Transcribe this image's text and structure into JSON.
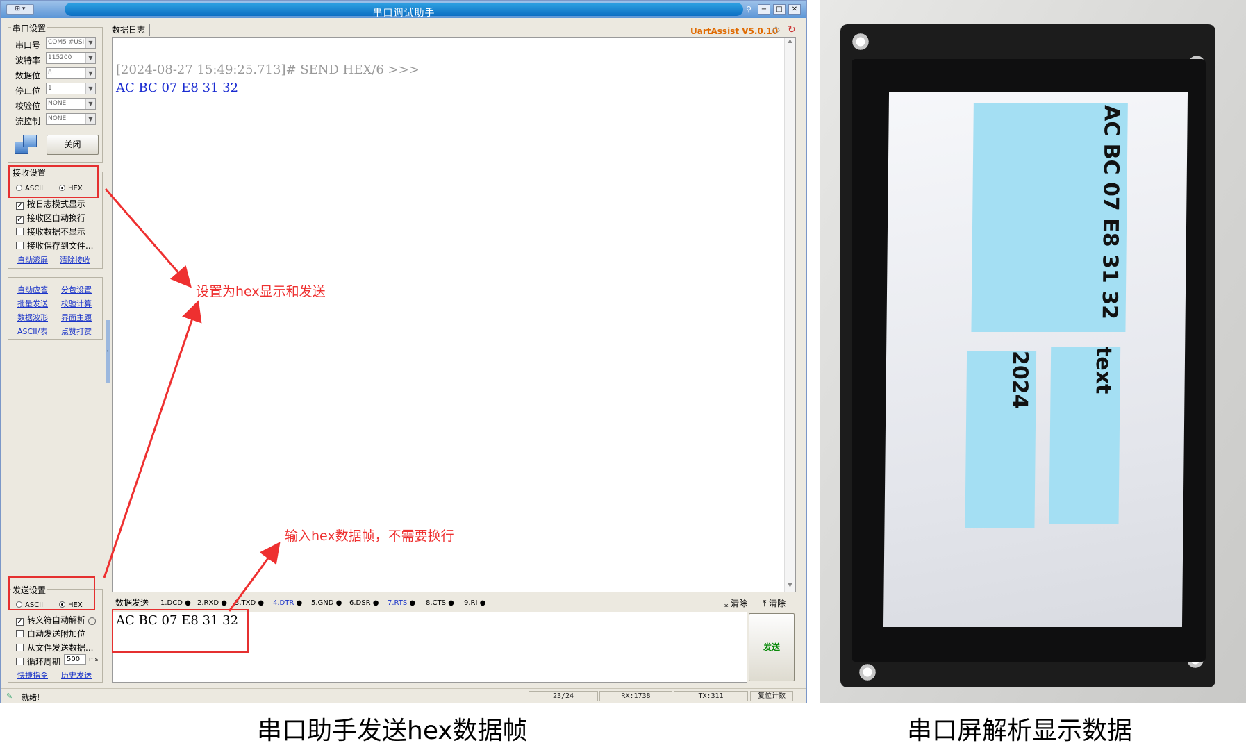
{
  "window": {
    "title": "串口调试助手",
    "sysmenu_label": "⊞ ▾",
    "brand": "UartAssist V5.0.10",
    "buttons": [
      "−",
      "□",
      "✕"
    ]
  },
  "serial_settings": {
    "legend": "串口设置",
    "fields": [
      {
        "label": "串口号",
        "value": "COM5 #USI"
      },
      {
        "label": "波特率",
        "value": "115200"
      },
      {
        "label": "数据位",
        "value": "8"
      },
      {
        "label": "停止位",
        "value": "1"
      },
      {
        "label": "校验位",
        "value": "NONE"
      },
      {
        "label": "流控制",
        "value": "NONE"
      }
    ],
    "close_label": "关闭"
  },
  "receive_settings": {
    "legend": "接收设置",
    "ascii_label": "ASCII",
    "hex_label": "HEX",
    "selected": "HEX",
    "options": [
      {
        "label": "按日志模式显示",
        "checked": true
      },
      {
        "label": "接收区自动换行",
        "checked": true
      },
      {
        "label": "接收数据不显示",
        "checked": false
      },
      {
        "label": "接收保存到文件...",
        "checked": false
      }
    ],
    "links": [
      "自动滚屏",
      "清除接收"
    ]
  },
  "tools": {
    "links": [
      "自动应答",
      "分包设置",
      "批量发送",
      "校验计算",
      "数据波形",
      "界面主题",
      "ASCII/表",
      "点赞打赏"
    ]
  },
  "send_settings": {
    "legend": "发送设置",
    "ascii_label": "ASCII",
    "hex_label": "HEX",
    "selected": "HEX",
    "options": [
      {
        "label": "转义符自动解析",
        "checked": true
      },
      {
        "label": "自动发送附加位",
        "checked": false
      },
      {
        "label": "从文件发送数据...",
        "checked": false
      },
      {
        "label": "循环周期",
        "checked": false
      }
    ],
    "period_value": "500",
    "period_unit": "ms",
    "links": [
      "快捷指令",
      "历史发送"
    ]
  },
  "log": {
    "tab_label": "数据日志",
    "header_line": "[2024-08-27 15:49:25.713]# SEND HEX/6 >>>",
    "data_line": "AC BC 07 E8 31 32"
  },
  "send_area": {
    "tab_label": "数据发送",
    "signals": [
      "1.DCD",
      "2.RXD",
      "3.TXD",
      "4.DTR",
      "5.GND",
      "6.DSR",
      "7.RTS",
      "8.CTS",
      "9.RI"
    ],
    "signal_links": [
      "4.DTR",
      "7.RTS"
    ],
    "clear1": "清除",
    "clear2": "清除",
    "input_value": "AC BC 07 E8 31 32",
    "send_button": "发送"
  },
  "status": {
    "text": "就绪!",
    "count": "23/24",
    "rx": "RX:1738",
    "tx": "TX:311",
    "reset": "复位计数"
  },
  "annotations": {
    "hex_note": "设置为hex显示和发送",
    "input_note": "输入hex数据帧，不需要换行",
    "color": "#ee3030"
  },
  "screen": {
    "box1_text": "AC BC 07 E8 31 32",
    "box2_text": "text",
    "box3_text": "2024",
    "box_color": "#a4dff3"
  },
  "captions": {
    "left": "串口助手发送hex数据帧",
    "right": "串口屏解析显示数据"
  }
}
